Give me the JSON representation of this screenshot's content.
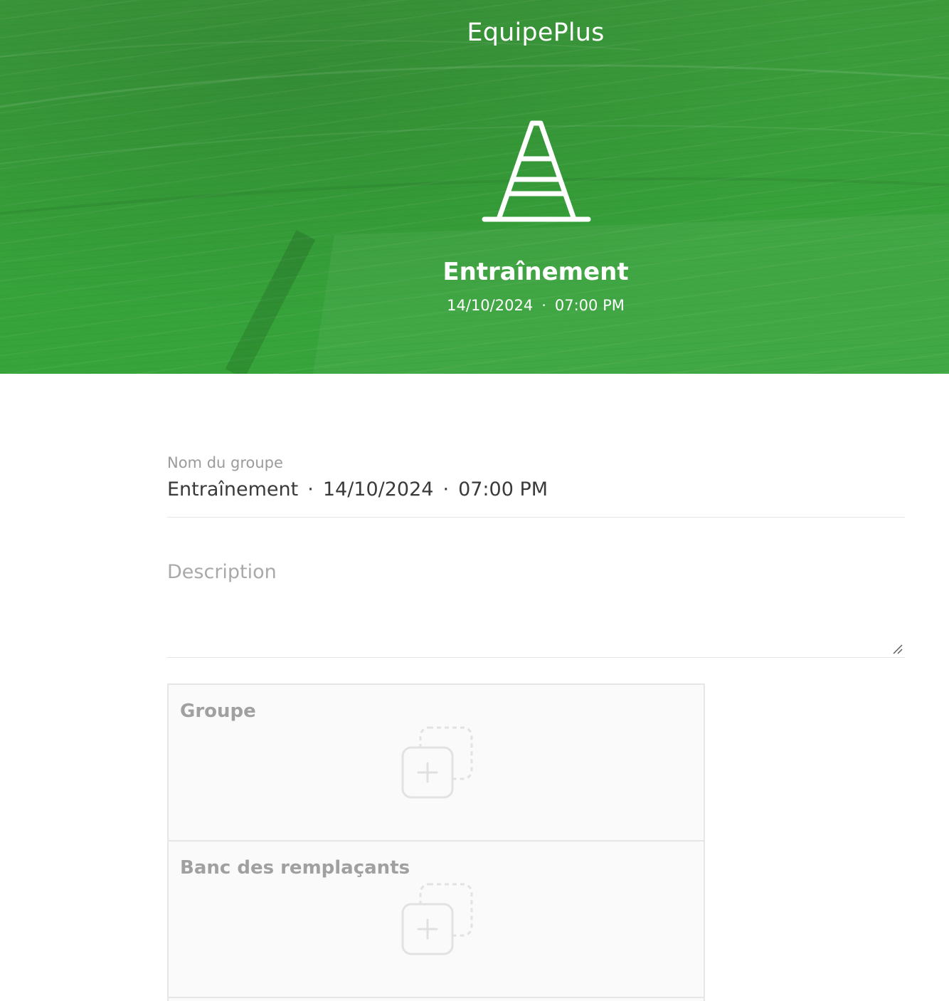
{
  "app": {
    "title": "EquipePlus"
  },
  "hero": {
    "icon": "training-cone-icon",
    "event_title": "Entraînement",
    "date": "14/10/2024",
    "separator": "·",
    "time": "07:00 PM",
    "brand_color": "#37a13a"
  },
  "form": {
    "group_name": {
      "label": "Nom du groupe",
      "value_title": "Entraînement",
      "value_date": "14/10/2024",
      "value_time": "07:00 PM",
      "separator": "·"
    },
    "description": {
      "placeholder": "Description",
      "value": ""
    }
  },
  "panels": [
    {
      "title": "Groupe",
      "action_icon": "add-player-icon"
    },
    {
      "title": "Banc des remplaçants",
      "action_icon": "add-player-icon"
    }
  ]
}
